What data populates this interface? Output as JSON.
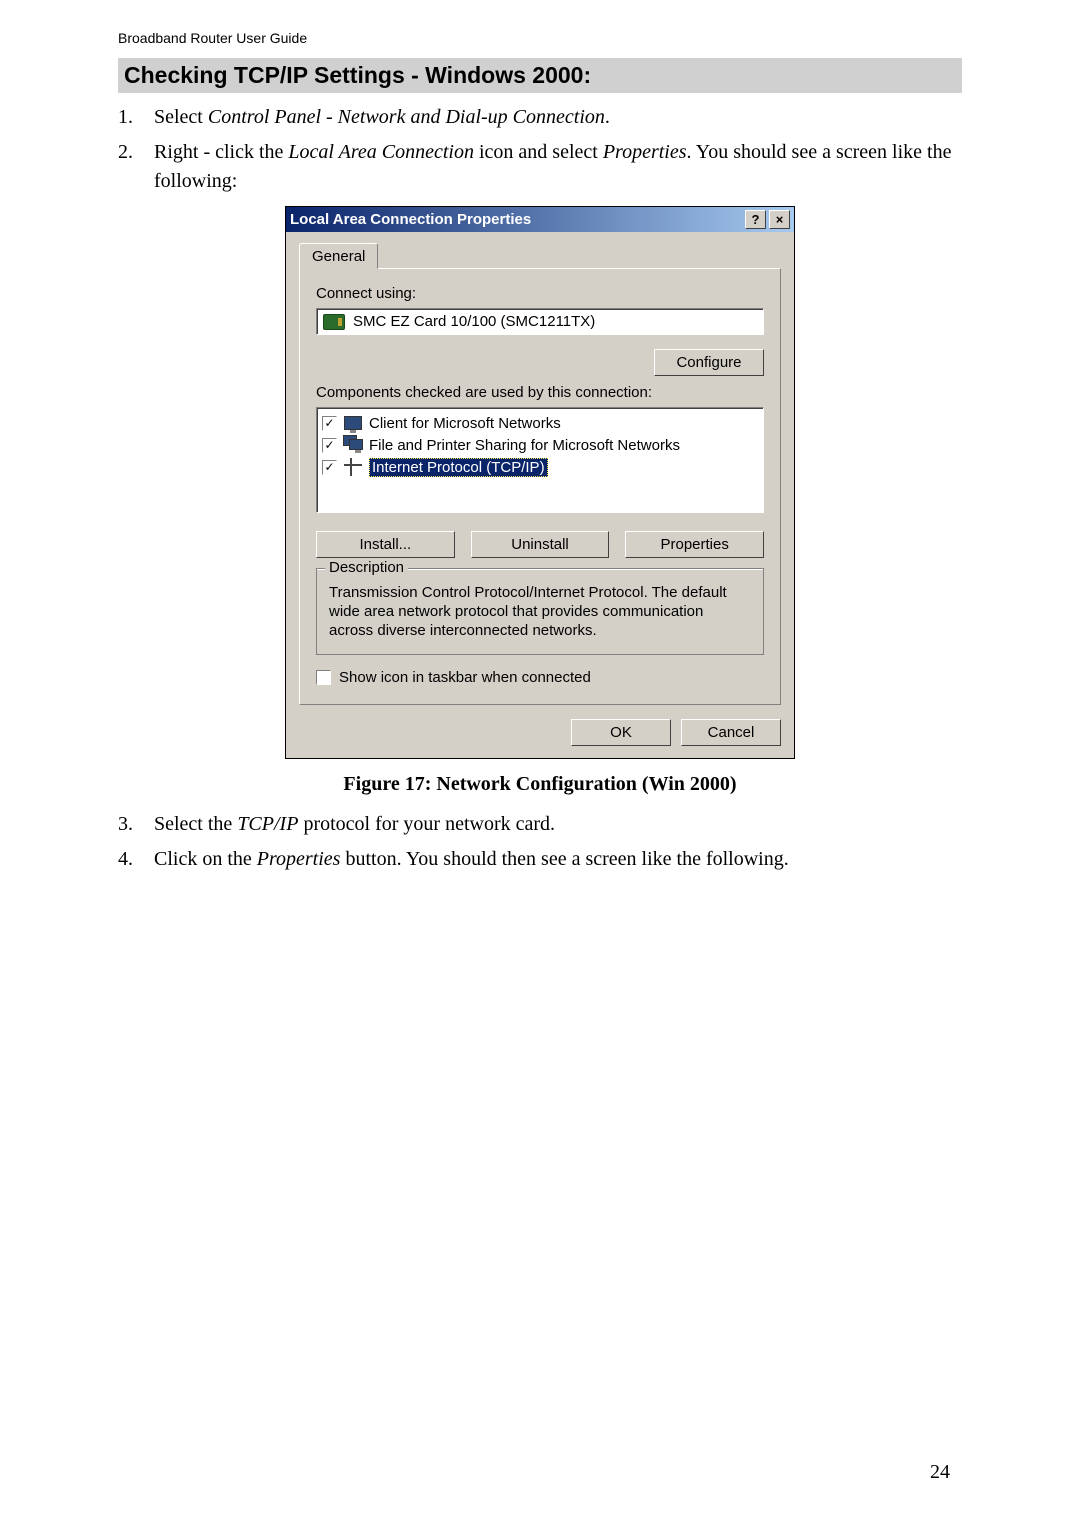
{
  "header": "Broadband Router User Guide",
  "sectionTitle": "Checking TCP/IP Settings - Windows 2000:",
  "steps": {
    "s1": {
      "num": "1.",
      "pre": "Select ",
      "it": "Control Panel - Network and Dial-up Connection",
      "post": "."
    },
    "s2": {
      "num": "2.",
      "pre": "Right - click the ",
      "it": "Local Area Connection",
      "mid": " icon and select ",
      "it2": "Properties",
      "post": ". You should see a screen like the following:"
    },
    "s3": {
      "num": "3.",
      "pre": "Select the ",
      "it": "TCP/IP",
      "post": " protocol for your network card."
    },
    "s4": {
      "num": "4.",
      "pre": "Click on the ",
      "it": "Properties",
      "post": " button. You should then see a screen like the following."
    }
  },
  "caption": "Figure 17: Network Configuration (Win 2000)",
  "pageNum": "24",
  "dlg": {
    "title": "Local Area Connection Properties",
    "help": "?",
    "close": "×",
    "tab": "General",
    "connectUsing": "Connect using:",
    "adapter": "SMC EZ Card 10/100 (SMC1211TX)",
    "configure": "Configure",
    "componentsLabel": "Components checked are used by this connection:",
    "comp1": "Client for Microsoft Networks",
    "comp2": "File and Printer Sharing for Microsoft Networks",
    "comp3": "Internet Protocol (TCP/IP)",
    "install": "Install...",
    "uninstall": "Uninstall",
    "properties": "Properties",
    "descLegend": "Description",
    "descText": "Transmission Control Protocol/Internet Protocol. The default wide area network protocol that provides communication across diverse interconnected networks.",
    "showIcon": "Show icon in taskbar when connected",
    "ok": "OK",
    "cancel": "Cancel"
  }
}
